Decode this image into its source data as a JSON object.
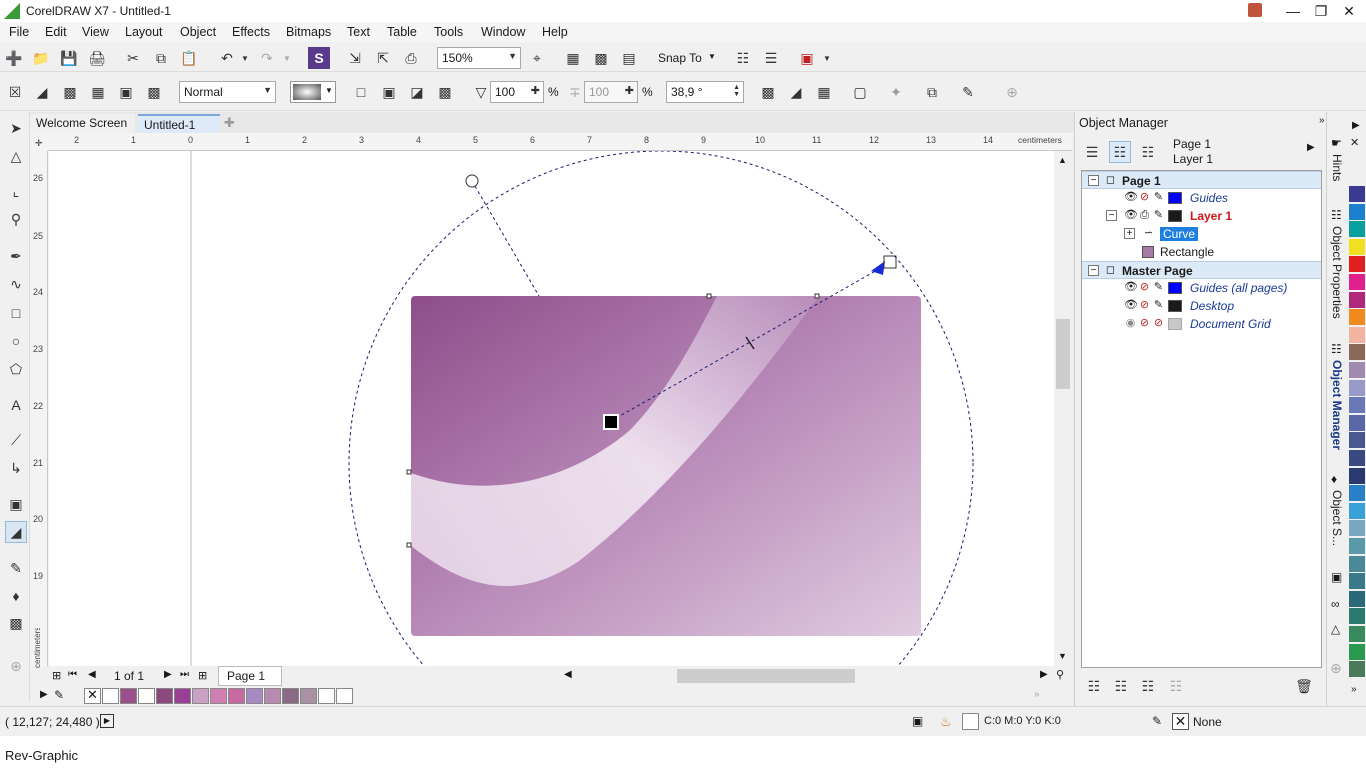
{
  "window": {
    "title": "CorelDRAW X7 - Untitled-1"
  },
  "menu": [
    "File",
    "Edit",
    "View",
    "Layout",
    "Object",
    "Effects",
    "Bitmaps",
    "Text",
    "Table",
    "Tools",
    "Window",
    "Help"
  ],
  "toolbar1": {
    "zoom_value": "150%",
    "snap_label": "Snap To"
  },
  "toolbar2": {
    "blend_mode": "Normal",
    "opacity_value": "100",
    "opacity_unit": "%",
    "opacity2_value": "100",
    "opacity2_unit": "%",
    "angle_value": "38,9 °"
  },
  "doc_tabs": [
    "Welcome Screen",
    "Untitled-1"
  ],
  "ruler": {
    "unit_h": "centimeters",
    "unit_v": "centimeters",
    "h_ticks": [
      "2",
      "1",
      "0",
      "1",
      "2",
      "3",
      "4",
      "5",
      "6",
      "7",
      "8",
      "9",
      "10",
      "11",
      "12",
      "13",
      "14"
    ],
    "v_ticks": [
      "26",
      "25",
      "24",
      "23",
      "22",
      "21",
      "20",
      "19",
      "18"
    ]
  },
  "page_nav": {
    "counter": "1 of 1",
    "page_tab": "Page 1"
  },
  "palette_strip": {
    "colors": [
      "#ffffff",
      "#9b4f8a",
      "#ffffff",
      "#8a4a7d",
      "#9b3f94",
      "#c9a2c3",
      "#cf7fb2",
      "#c86aa2",
      "#a68ac2",
      "#b78ab2",
      "#8b6a86",
      "#a891a3",
      "#ffffff",
      "#ffffff"
    ]
  },
  "status": {
    "coords": "( 12,127; 24,480 )",
    "fill_info": "C:0 M:0 Y:0 K:0",
    "outline_info": "None"
  },
  "footer": {
    "text": "Rev-Graphic"
  },
  "object_manager": {
    "title": "Object Manager",
    "page_label": "Page 1",
    "layer_label": "Layer 1",
    "tree": [
      {
        "label": "Page 1",
        "level": 0,
        "bold": true,
        "highlight": true
      },
      {
        "label": "Guides",
        "level": 1,
        "color": "#0000ff",
        "italic": true
      },
      {
        "label": "Layer 1",
        "level": 1,
        "color": "#1a1a1a",
        "bold": true,
        "red": true
      },
      {
        "label": "Curve",
        "level": 2,
        "selected": true
      },
      {
        "label": "Rectangle",
        "level": 2
      },
      {
        "label": "Master Page",
        "level": 0,
        "bold": true,
        "highlight": true
      },
      {
        "label": "Guides (all pages)",
        "level": 1,
        "color": "#0000ff",
        "italic": true
      },
      {
        "label": "Desktop",
        "level": 1,
        "color": "#1a1a1a",
        "italic": true
      },
      {
        "label": "Document Grid",
        "level": 1,
        "color": "#c0c0c0",
        "italic": true
      }
    ]
  },
  "docker_tabs": [
    "Hints",
    "Object Properties",
    "Object Manager",
    "Object S..."
  ],
  "color_palette": [
    "#3a3a90",
    "#1e7fd0",
    "#0aa0a0",
    "#f0e020",
    "#e02020",
    "#e0208c",
    "#b0287a",
    "#f08a1e",
    "#f4b4a4",
    "#8a6a5a",
    "#a08ab0",
    "#9a9ac8",
    "#6a78b8",
    "#5a68a8",
    "#4a5890",
    "#3a4a80",
    "#2a3a70",
    "#2a80c8",
    "#3aa0d8",
    "#78a8c0",
    "#5a9aa8",
    "#4a8a98",
    "#3a7a88",
    "#2a6a78",
    "#2a7a70",
    "#3a8a60",
    "#2a9a50",
    "#4a7a5a"
  ]
}
